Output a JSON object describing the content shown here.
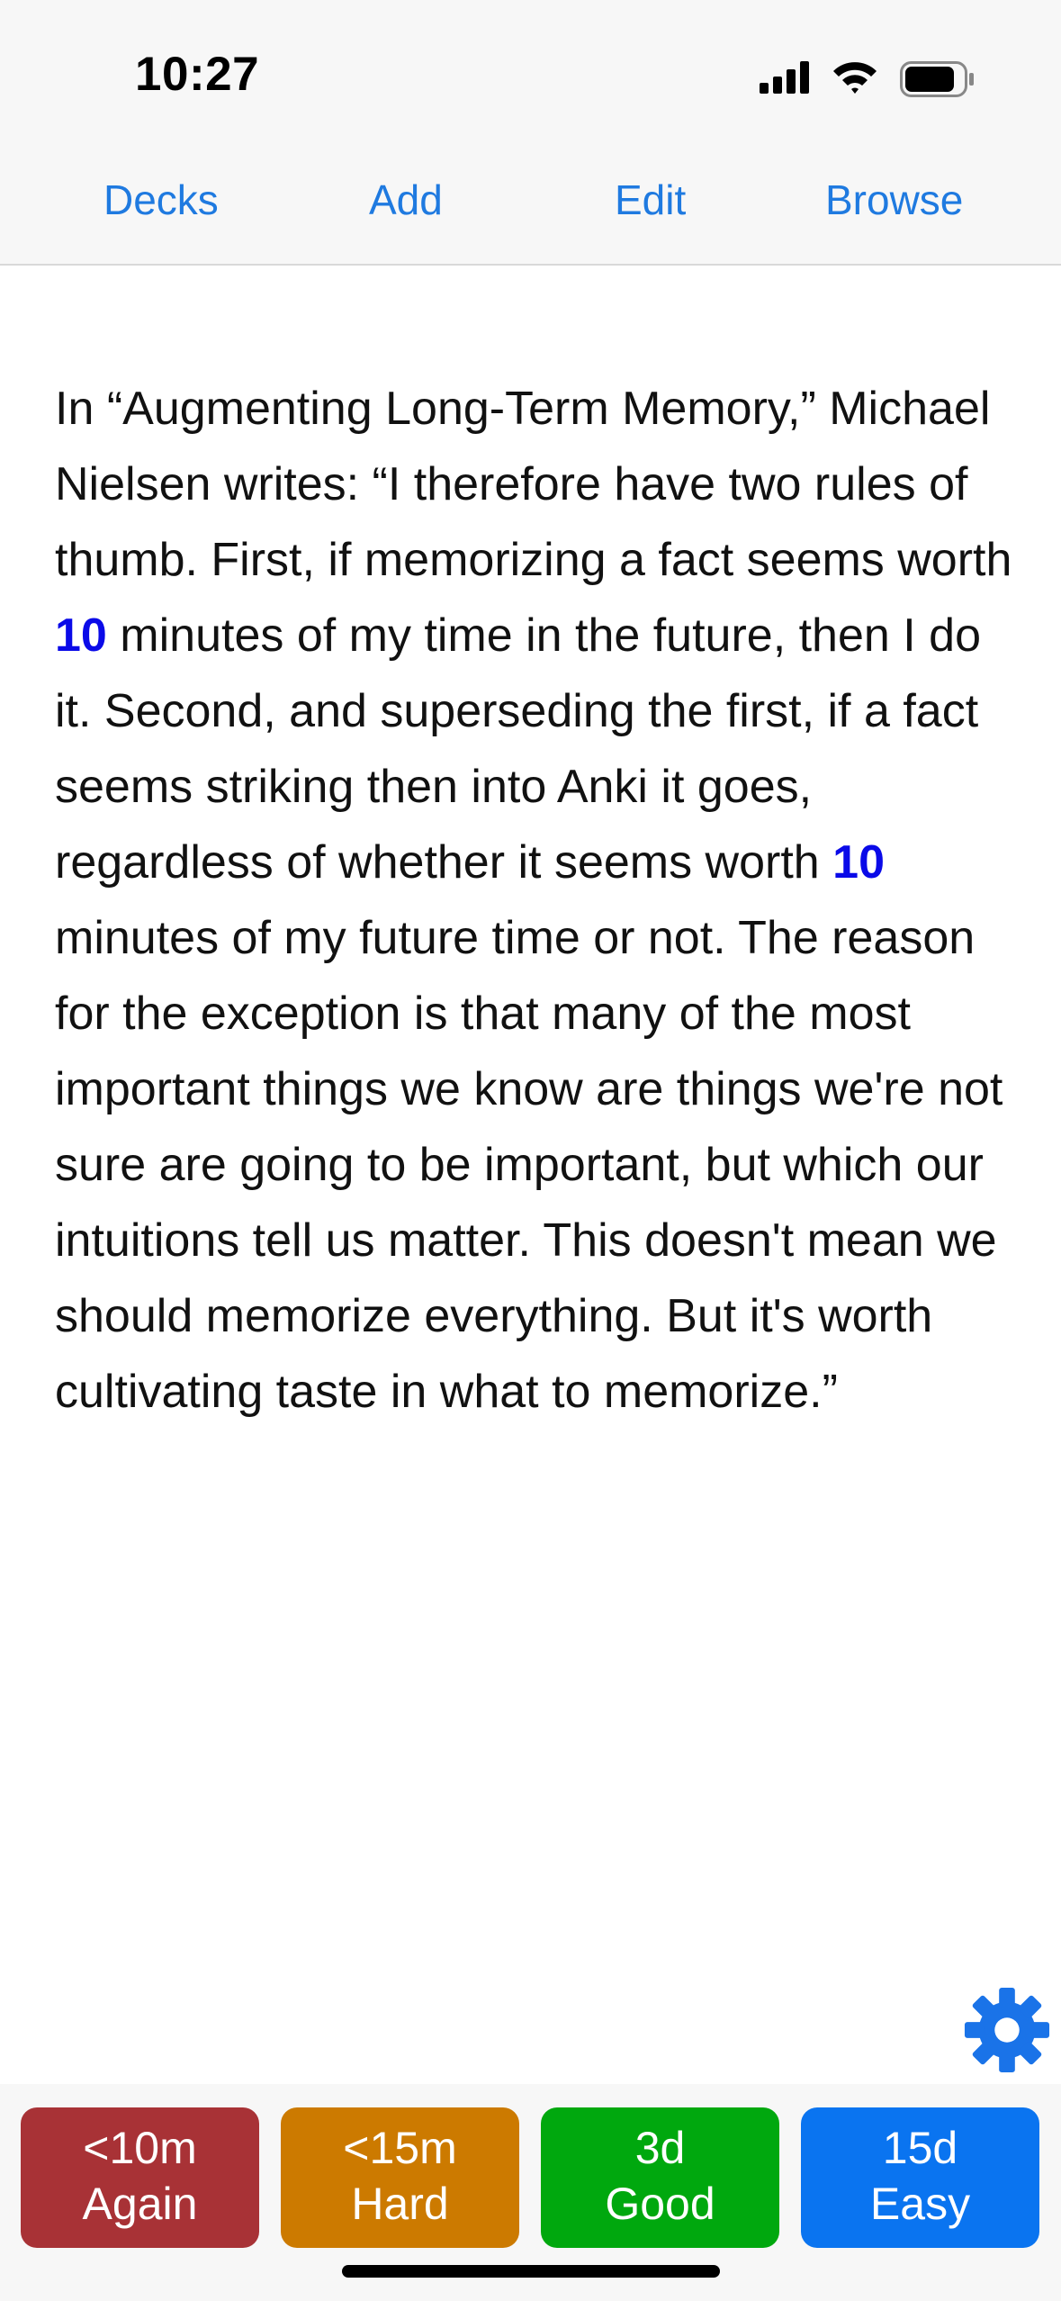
{
  "status_bar": {
    "time": "10:27",
    "icons": [
      "cellular-signal-icon",
      "wifi-icon",
      "battery-icon"
    ]
  },
  "nav": {
    "decks": "Decks",
    "add": "Add",
    "edit": "Edit",
    "browse": "Browse"
  },
  "card": {
    "seg1": "In “Augmenting Long-Term Memory,” Michael Nielsen writes: “I therefore have two rules of thumb. First, if memorizing a fact seems worth ",
    "cloze1": "10",
    "seg2": " minutes of my time in the future, then I do it. Second, and superseding the first, if a fact seems striking then into Anki it goes, regardless of whether it seems worth ",
    "cloze2": "10",
    "seg3": " minutes of my future time or not. The reason for the exception is that many of the most important things we know are things we're not sure are going to be important, but which our intuitions tell us matter. This doesn't mean we should memorize everything. But it's worth cultivating taste in what to memorize.”"
  },
  "settings": {
    "icon": "gear-icon"
  },
  "answers": [
    {
      "interval": "<10m",
      "label": "Again",
      "color": "#a83236"
    },
    {
      "interval": "<15m",
      "label": "Hard",
      "color": "#cc7a00"
    },
    {
      "interval": "3d",
      "label": "Good",
      "color": "#00a80e"
    },
    {
      "interval": "15d",
      "label": "Easy",
      "color": "#0a74f0"
    }
  ],
  "colors": {
    "nav_accent": "#1f7ae0",
    "cloze_highlight": "#0a0ae8",
    "gear": "#1a73e8"
  }
}
